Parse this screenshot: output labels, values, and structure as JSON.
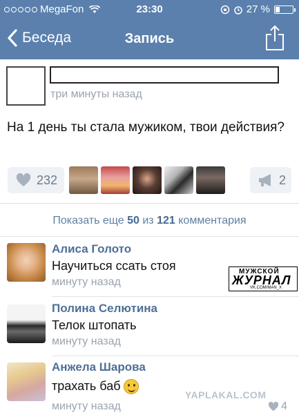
{
  "status_bar": {
    "carrier": "MegaFon",
    "time": "23:30",
    "battery": "27 %",
    "battery_level": 0.27
  },
  "nav": {
    "back_label": "Беседа",
    "title": "Запись"
  },
  "post": {
    "time": "три минуты назад",
    "text": "На 1 день ты стала мужиком, твои действия?",
    "likes": "232",
    "reposts": "2"
  },
  "show_more": {
    "prefix": "Показать еще",
    "shown": "50",
    "middle": "из",
    "total": "121",
    "suffix": "комментария"
  },
  "comments": [
    {
      "author": "Алиса Голото",
      "text": "Научиться ссать стоя",
      "time": "минуту назад"
    },
    {
      "author": "Полина Селютина",
      "text": "Телок штопать",
      "time": "минуту назад"
    },
    {
      "author": "Анжела Шарова",
      "text": "трахать баб",
      "time": "минуту назад",
      "likes": "4"
    }
  ],
  "watermark": {
    "line1": "МУЖСКОЙ",
    "line2": "ЖУРНАЛ",
    "line3": "VK.COM/MAN_X"
  },
  "watermark2": "YAPLAKAL.COM",
  "colors": {
    "header_bg": "#5b80ad",
    "link_blue": "#4d6f97",
    "muted_gray": "#9aa3ad"
  }
}
